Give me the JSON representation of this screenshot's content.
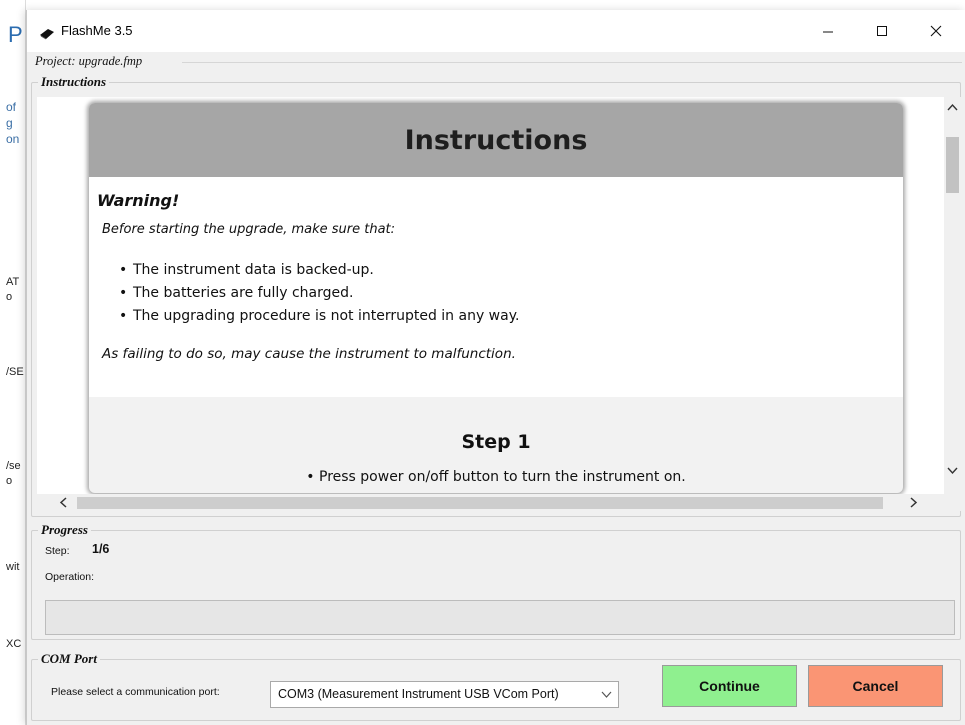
{
  "background_app": {
    "big_letter": "P",
    "fragments": [
      "of",
      "g",
      "on",
      "AT",
      "o",
      "/SE",
      "/se",
      "o",
      "wit",
      "XC"
    ]
  },
  "window": {
    "title": "FlashMe 3.5",
    "icon": "chip-icon",
    "controls": {
      "minimize": "minimize-icon",
      "maximize": "maximize-icon",
      "close": "close-icon"
    }
  },
  "project": {
    "label": "Project: upgrade.fmp"
  },
  "instructions": {
    "group_label": "Instructions",
    "doc_title": "Instructions",
    "warning_title": "Warning!",
    "warning_intro": "Before starting the upgrade, make sure that:",
    "warning_items": [
      "The instrument data is backed-up.",
      "The batteries are fully charged.",
      "The upgrading procedure is not interrupted in any way."
    ],
    "warning_outro": "As failing to do so, may cause the instrument to malfunction.",
    "step_title": "Step 1",
    "step_item": "Press power on/off button to turn the instrument on."
  },
  "progress": {
    "group_label": "Progress",
    "step_label": "Step:",
    "step_value": "1/6",
    "operation_label": "Operation:",
    "operation_value": "",
    "fill_fraction": 0
  },
  "com_port": {
    "group_label": "COM Port",
    "prompt": "Please select a communication port:",
    "selected": "COM3 (Measurement Instrument USB VCom Port)"
  },
  "buttons": {
    "continue": "Continue",
    "cancel": "Cancel"
  },
  "colors": {
    "continue_bg": "#8ff08f",
    "cancel_bg": "#fa9574",
    "doc_header_bg": "#a6a6a6",
    "window_bg": "#f0f0f0"
  }
}
